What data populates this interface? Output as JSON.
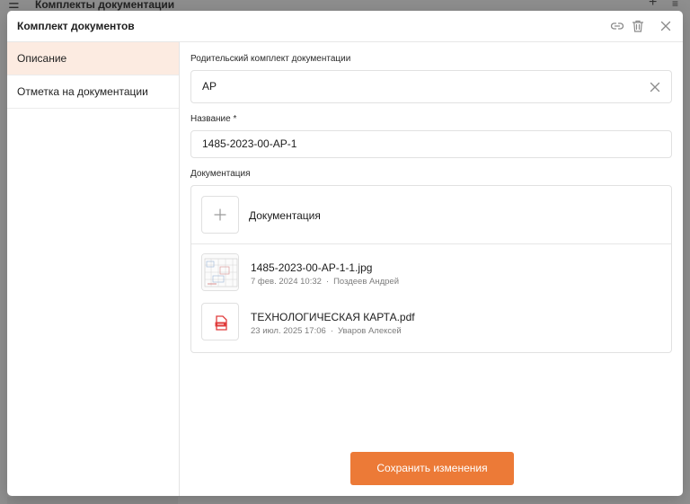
{
  "background": {
    "app_title": "Комплекты документации"
  },
  "modal": {
    "title": "Комплект документов"
  },
  "sidebar": {
    "items": [
      {
        "label": "Описание",
        "active": true
      },
      {
        "label": "Отметка на документации",
        "active": false
      }
    ]
  },
  "form": {
    "parent_label": "Родительский комплект документации",
    "parent_value": "АР",
    "name_label": "Название *",
    "name_value": "1485-2023-00-АР-1",
    "docs_label": "Документация",
    "add_label": "Документация"
  },
  "files": [
    {
      "name": "1485-2023-00-АР-1-1.jpg",
      "date": "7 фев. 2024 10:32",
      "author": "Поздеев Андрей",
      "type": "image"
    },
    {
      "name": "ТЕХНОЛОГИЧЕСКАЯ КАРТА.pdf",
      "date": "23 июл. 2025 17:06",
      "author": "Уваров Алексей",
      "type": "pdf"
    }
  ],
  "actions": {
    "save_label": "Сохранить изменения"
  },
  "colors": {
    "accent": "#ec7a37",
    "active_bg": "#fcebe1",
    "pdf_red": "#e03b3b"
  },
  "icons": {
    "link": "link-icon",
    "trash": "trash-icon",
    "close": "close-icon",
    "clear": "clear-icon",
    "plus": "plus-icon",
    "pdf": "pdf-file-icon"
  }
}
